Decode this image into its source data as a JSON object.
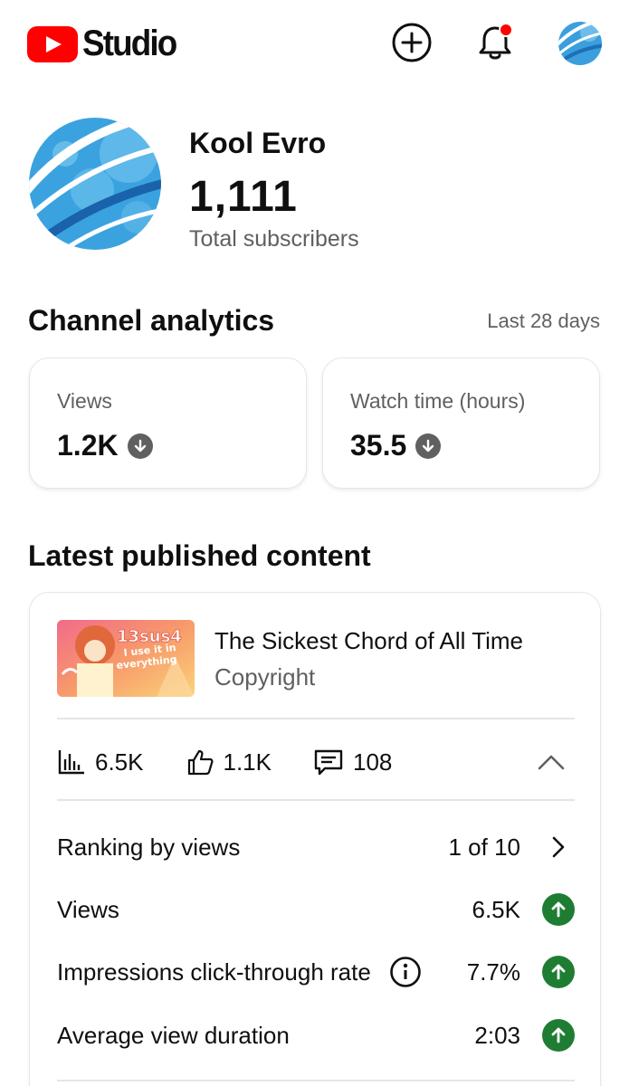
{
  "header": {
    "logo_text": "Studio",
    "icons": [
      "youtube-logo-icon",
      "create-plus-icon",
      "bell-icon",
      "account-avatar"
    ],
    "notification_dot_color": "#ff0000"
  },
  "channel": {
    "name": "Kool Evro",
    "subscribers": "1,111",
    "subscribers_label": "Total subscribers"
  },
  "analytics": {
    "title": "Channel analytics",
    "period": "Last 28 days",
    "cards": [
      {
        "label": "Views",
        "value": "1.2K",
        "trend": "down"
      },
      {
        "label": "Watch time (hours)",
        "value": "35.5",
        "trend": "down"
      }
    ]
  },
  "latest": {
    "title": "Latest published content",
    "video": {
      "title": "The Sickest Chord of All Time",
      "status": "Copyright",
      "thumbnail_text": [
        "13sus4",
        "I use it in",
        "everything"
      ]
    },
    "stats": {
      "views": "6.5K",
      "likes": "1.1K",
      "comments": "108"
    },
    "metrics": [
      {
        "label": "Ranking by views",
        "value": "1 of 10",
        "trail": "chevron-right"
      },
      {
        "label": "Views",
        "value": "6.5K",
        "trail": "up"
      },
      {
        "label": "Impressions click-through rate",
        "value": "7.7%",
        "trail": "up",
        "info": true
      },
      {
        "label": "Average view duration",
        "value": "2:03",
        "trail": "up"
      }
    ]
  },
  "colors": {
    "brand_red": "#ff0000",
    "trend_up": "#1e7d32",
    "trend_down": "#606060",
    "secondary_text": "#606060"
  }
}
